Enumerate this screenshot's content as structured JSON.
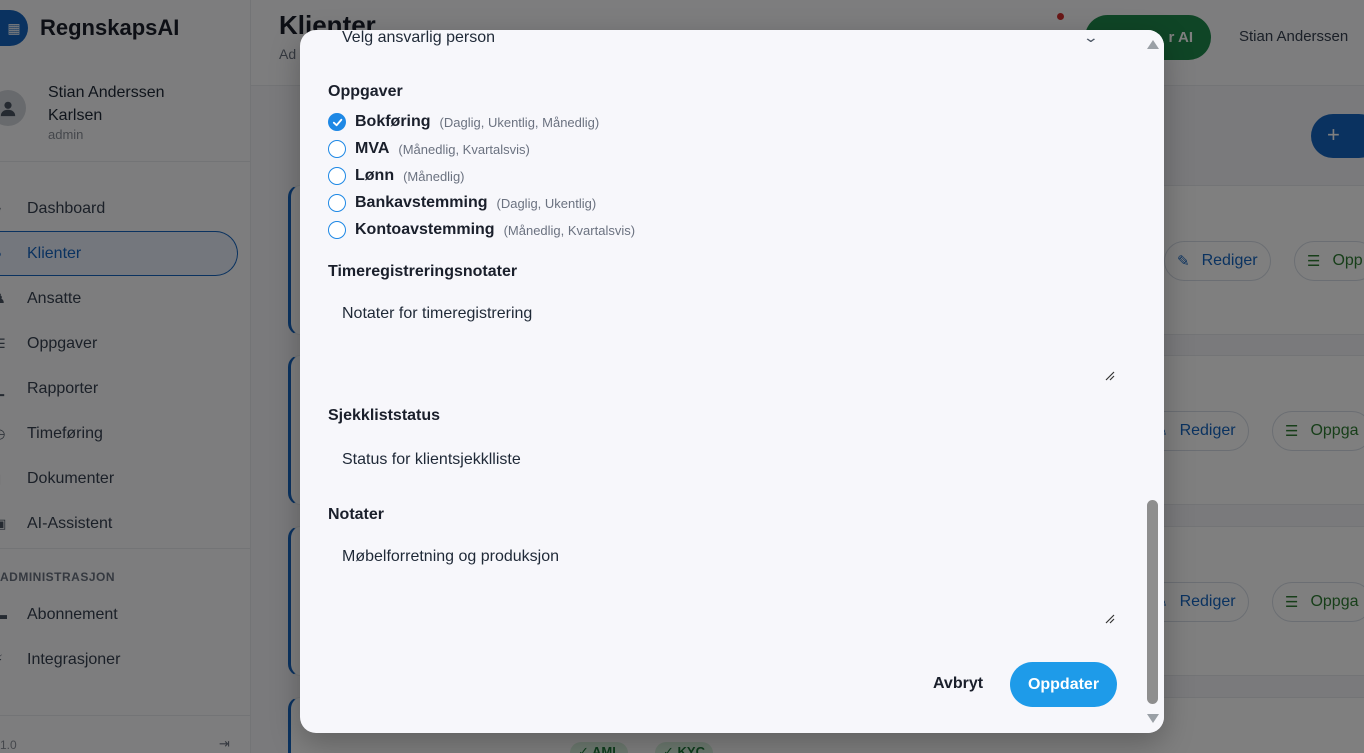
{
  "app": {
    "brand_name": "RegnskapsAI",
    "user_name": "Stian Anderssen Karlsen",
    "user_role": "admin",
    "version": "1.0"
  },
  "sidebar": {
    "items": [
      {
        "label": "Dashboard",
        "icon": "dashboard-icon"
      },
      {
        "label": "Klienter",
        "icon": "clients-icon"
      },
      {
        "label": "Ansatte",
        "icon": "employees-icon"
      },
      {
        "label": "Oppgaver",
        "icon": "tasks-icon"
      },
      {
        "label": "Rapporter",
        "icon": "reports-icon"
      },
      {
        "label": "Timeføring",
        "icon": "time-icon"
      },
      {
        "label": "Dokumenter",
        "icon": "documents-icon"
      },
      {
        "label": "AI-Assistent",
        "icon": "robot-icon"
      }
    ],
    "admin_section_label": "ADMINISTRASJON",
    "admin_items": [
      {
        "label": "Abonnement",
        "icon": "card-icon"
      },
      {
        "label": "Integrasjoner",
        "icon": "plug-icon"
      }
    ]
  },
  "header": {
    "title": "Klienter",
    "subtitle": "Ad",
    "ai_button_label": "r AI",
    "user_display": "Stian Anderssen",
    "add_button_icon": "+"
  },
  "cards": {
    "edit_label": "Rediger",
    "tasks_label_full": "Oppgaver",
    "tasks_label_a": "Opp",
    "tasks_label_b": "Oppga",
    "tag_aml": "✓ AML",
    "tag_kyc": "✓ KYC"
  },
  "modal": {
    "responsible_placeholder": "Velg ansvarlig person",
    "tasks_label": "Oppgaver",
    "tasks": [
      {
        "name": "Bokføring",
        "frequency": "(Daglig, Ukentlig, Månedlig)",
        "checked": true
      },
      {
        "name": "MVA",
        "frequency": "(Månedlig, Kvartalsvis)",
        "checked": false
      },
      {
        "name": "Lønn",
        "frequency": "(Månedlig)",
        "checked": false
      },
      {
        "name": "Bankavstemming",
        "frequency": "(Daglig, Ukentlig)",
        "checked": false
      },
      {
        "name": "Kontoavstemming",
        "frequency": "(Månedlig, Kvartalsvis)",
        "checked": false
      }
    ],
    "time_notes_label": "Timeregistreringsnotater",
    "time_notes_value": "Notater for timeregistrering",
    "checklist_label": "Sjekkliststatus",
    "checklist_value": "Status for klientsjekklliste",
    "notes_label": "Notater",
    "notes_value": "Møbelforretning og produksjon",
    "cancel_label": "Avbryt",
    "update_label": "Oppdater"
  },
  "colors": {
    "primary": "#1565c0",
    "accent": "#1e9be9",
    "success": "#1e8a4c"
  }
}
